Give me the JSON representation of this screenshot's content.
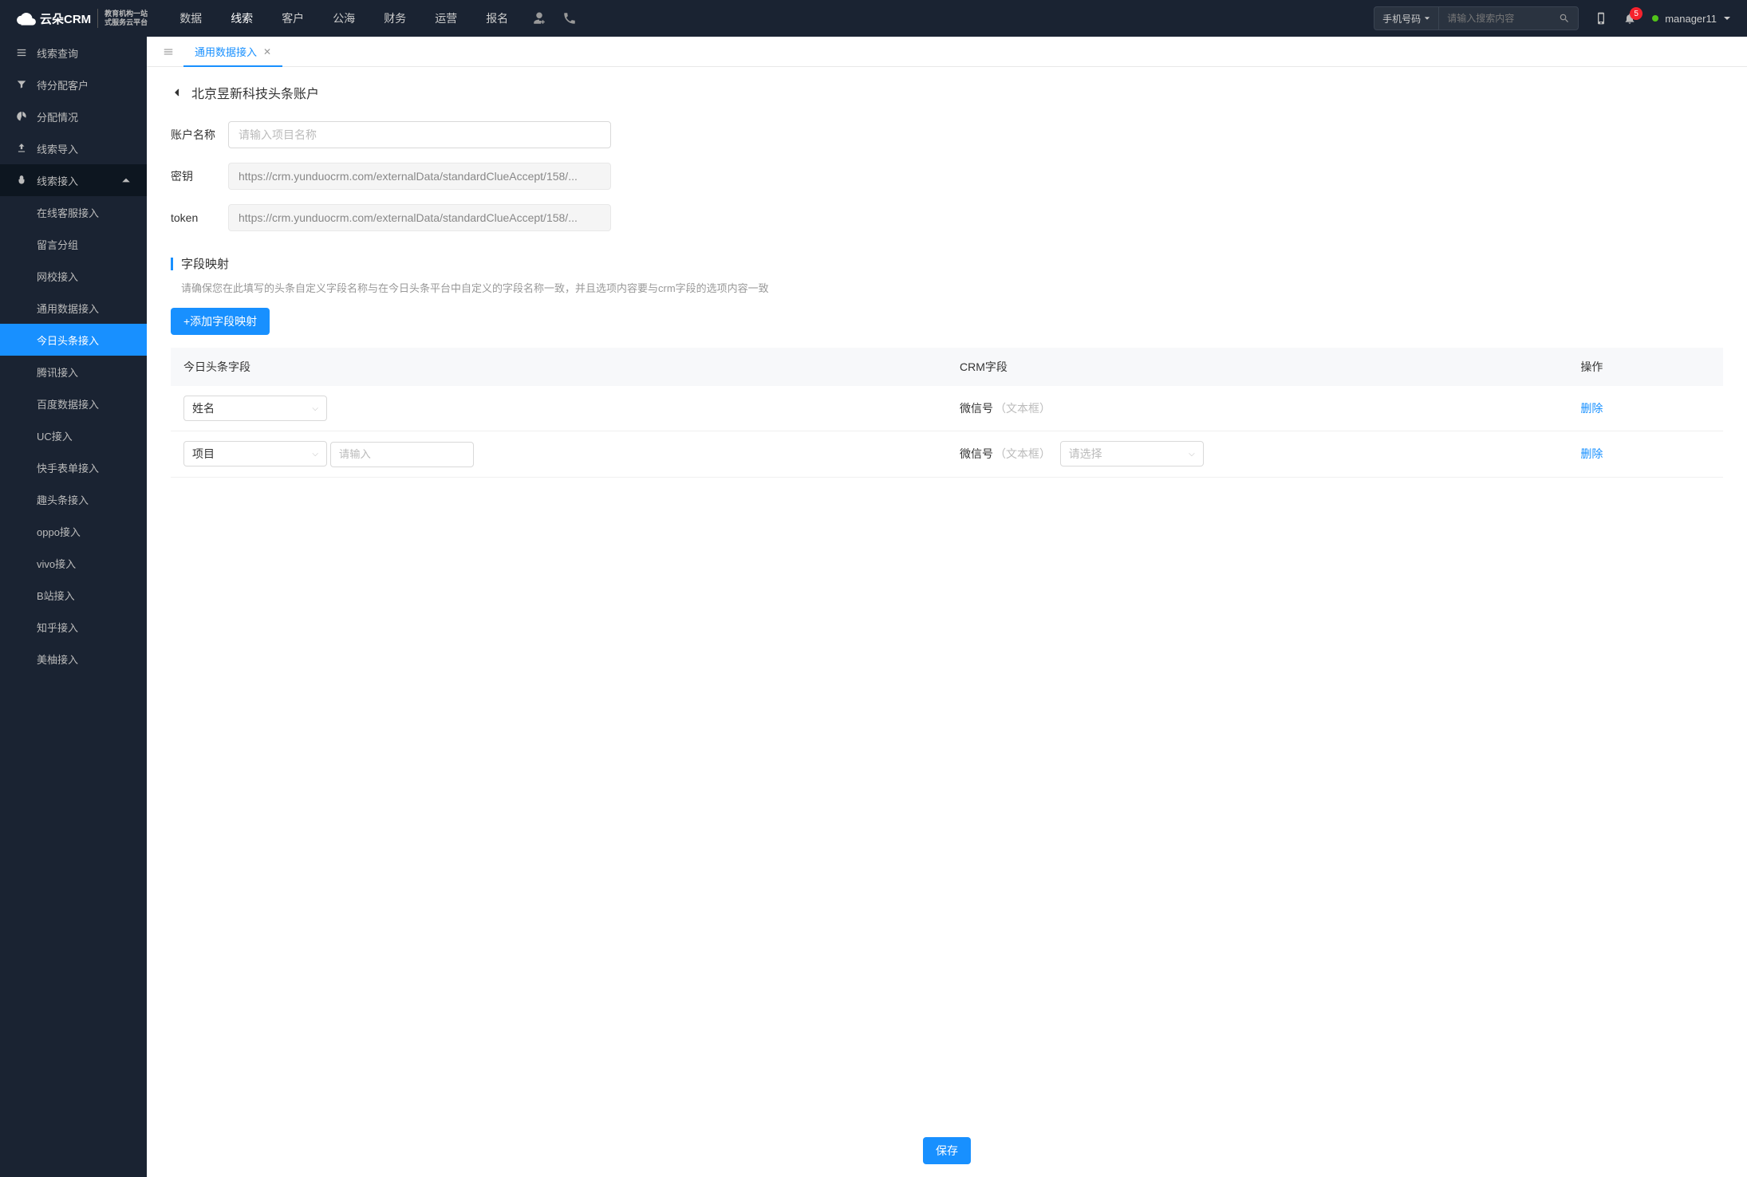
{
  "logo": {
    "brand": "云朵CRM",
    "sub1": "教育机构一站",
    "sub2": "式服务云平台"
  },
  "nav": {
    "items": [
      "数据",
      "线索",
      "客户",
      "公海",
      "财务",
      "运营",
      "报名"
    ],
    "active_index": 1
  },
  "search": {
    "filter_label": "手机号码",
    "placeholder": "请输入搜索内容"
  },
  "notif_count": "5",
  "user": {
    "name": "manager11"
  },
  "sidebar": {
    "items": [
      {
        "label": "线索查询",
        "icon": "list"
      },
      {
        "label": "待分配客户",
        "icon": "filter"
      },
      {
        "label": "分配情况",
        "icon": "pie"
      },
      {
        "label": "线索导入",
        "icon": "import"
      },
      {
        "label": "线索接入",
        "icon": "plug",
        "expanded": true,
        "children": [
          "在线客服接入",
          "留言分组",
          "网校接入",
          "通用数据接入",
          "今日头条接入",
          "腾讯接入",
          "百度数据接入",
          "UC接入",
          "快手表单接入",
          "趣头条接入",
          "oppo接入",
          "vivo接入",
          "B站接入",
          "知乎接入",
          "美柚接入"
        ],
        "active_child_index": 4
      }
    ]
  },
  "tabs": {
    "items": [
      {
        "label": "通用数据接入",
        "active": true
      }
    ]
  },
  "page": {
    "title": "北京昱新科技头条账户",
    "account_name_label": "账户名称",
    "account_name_placeholder": "请输入项目名称",
    "secret_label": "密钥",
    "secret_value": "https://crm.yunduocrm.com/externalData/standardClueAccept/158/...",
    "token_label": "token",
    "token_value": "https://crm.yunduocrm.com/externalData/standardClueAccept/158/...",
    "mapping_title": "字段映射",
    "mapping_desc": "请确保您在此填写的头条自定义字段名称与在今日头条平台中自定义的字段名称一致，并且选项内容要与crm字段的选项内容一致",
    "add_mapping_btn": "+添加字段映射",
    "table": {
      "headers": [
        "今日头条字段",
        "CRM字段",
        "操作"
      ],
      "rows": [
        {
          "tt_field": "姓名",
          "crm_field_name": "微信号",
          "crm_field_type": "（文本框）",
          "has_extra_input": false,
          "has_crm_select": false,
          "action": "删除"
        },
        {
          "tt_field": "项目",
          "extra_input_placeholder": "请输入",
          "crm_field_name": "微信号",
          "crm_field_type": "（文本框）",
          "has_extra_input": true,
          "has_crm_select": true,
          "crm_select_placeholder": "请选择",
          "action": "删除"
        }
      ]
    },
    "save_btn": "保存"
  }
}
